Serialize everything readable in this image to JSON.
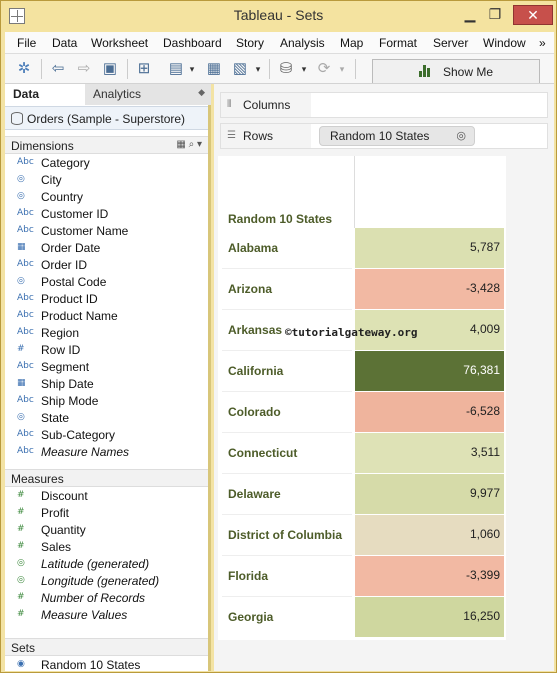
{
  "window": {
    "title": "Tableau - Sets"
  },
  "menu": [
    "File",
    "Data",
    "Worksheet",
    "Dashboard",
    "Story",
    "Analysis",
    "Map",
    "Format",
    "Server",
    "Window",
    "»"
  ],
  "toolbar": {
    "show_me_label": "Show Me"
  },
  "data_pane": {
    "tabs": [
      "Data",
      "Analytics"
    ],
    "datasource": "Orders (Sample - Superstore)",
    "dimensions_title": "Dimensions",
    "dimensions": [
      {
        "icon": "Abc",
        "label": "Category"
      },
      {
        "icon": "globe",
        "label": "City"
      },
      {
        "icon": "globe",
        "label": "Country"
      },
      {
        "icon": "Abc",
        "label": "Customer ID"
      },
      {
        "icon": "Abc",
        "label": "Customer Name"
      },
      {
        "icon": "calendar",
        "label": "Order Date"
      },
      {
        "icon": "Abc",
        "label": "Order ID"
      },
      {
        "icon": "globe",
        "label": "Postal Code"
      },
      {
        "icon": "Abc",
        "label": "Product ID"
      },
      {
        "icon": "Abc",
        "label": "Product Name"
      },
      {
        "icon": "Abc",
        "label": "Region"
      },
      {
        "icon": "#",
        "label": "Row ID"
      },
      {
        "icon": "Abc",
        "label": "Segment"
      },
      {
        "icon": "calendar",
        "label": "Ship Date"
      },
      {
        "icon": "Abc",
        "label": "Ship Mode"
      },
      {
        "icon": "globe",
        "label": "State"
      },
      {
        "icon": "Abc",
        "label": "Sub-Category"
      },
      {
        "icon": "Abc",
        "label": "Measure Names",
        "italic": true
      }
    ],
    "measures_title": "Measures",
    "measures": [
      {
        "icon": "#",
        "label": "Discount"
      },
      {
        "icon": "#",
        "label": "Profit"
      },
      {
        "icon": "#",
        "label": "Quantity"
      },
      {
        "icon": "#",
        "label": "Sales"
      },
      {
        "icon": "globe",
        "label": "Latitude (generated)",
        "italic": true
      },
      {
        "icon": "globe",
        "label": "Longitude (generated)",
        "italic": true
      },
      {
        "icon": "#",
        "label": "Number of Records",
        "italic": true
      },
      {
        "icon": "#",
        "label": "Measure Values",
        "italic": true
      }
    ],
    "sets_title": "Sets",
    "sets": [
      {
        "icon": "set",
        "label": "Random 10 States"
      }
    ]
  },
  "shelves": {
    "columns_label": "Columns",
    "rows_label": "Rows",
    "rows_pill": "Random 10 States"
  },
  "viz": {
    "row_header": "Random 10 States",
    "watermark": "©tutorialgateway.org",
    "rows": [
      {
        "state": "Alabama",
        "value": "5,787",
        "color": "#dbe0b1"
      },
      {
        "state": "Arizona",
        "value": "-3,428",
        "color": "#f2b9a3"
      },
      {
        "state": "Arkansas",
        "value": "4,009",
        "color": "#dde2b4"
      },
      {
        "state": "California",
        "value": "76,381",
        "color": "#5c7236"
      },
      {
        "state": "Colorado",
        "value": "-6,528",
        "color": "#efb49d"
      },
      {
        "state": "Connecticut",
        "value": "3,511",
        "color": "#dee2b6"
      },
      {
        "state": "Delaware",
        "value": "9,977",
        "color": "#d6dba9"
      },
      {
        "state": "District of Columbia",
        "value": "1,060",
        "color": "#e6dcc0"
      },
      {
        "state": "Florida",
        "value": "-3,399",
        "color": "#f2b9a3"
      },
      {
        "state": "Georgia",
        "value": "16,250",
        "color": "#cfd79f"
      }
    ]
  }
}
